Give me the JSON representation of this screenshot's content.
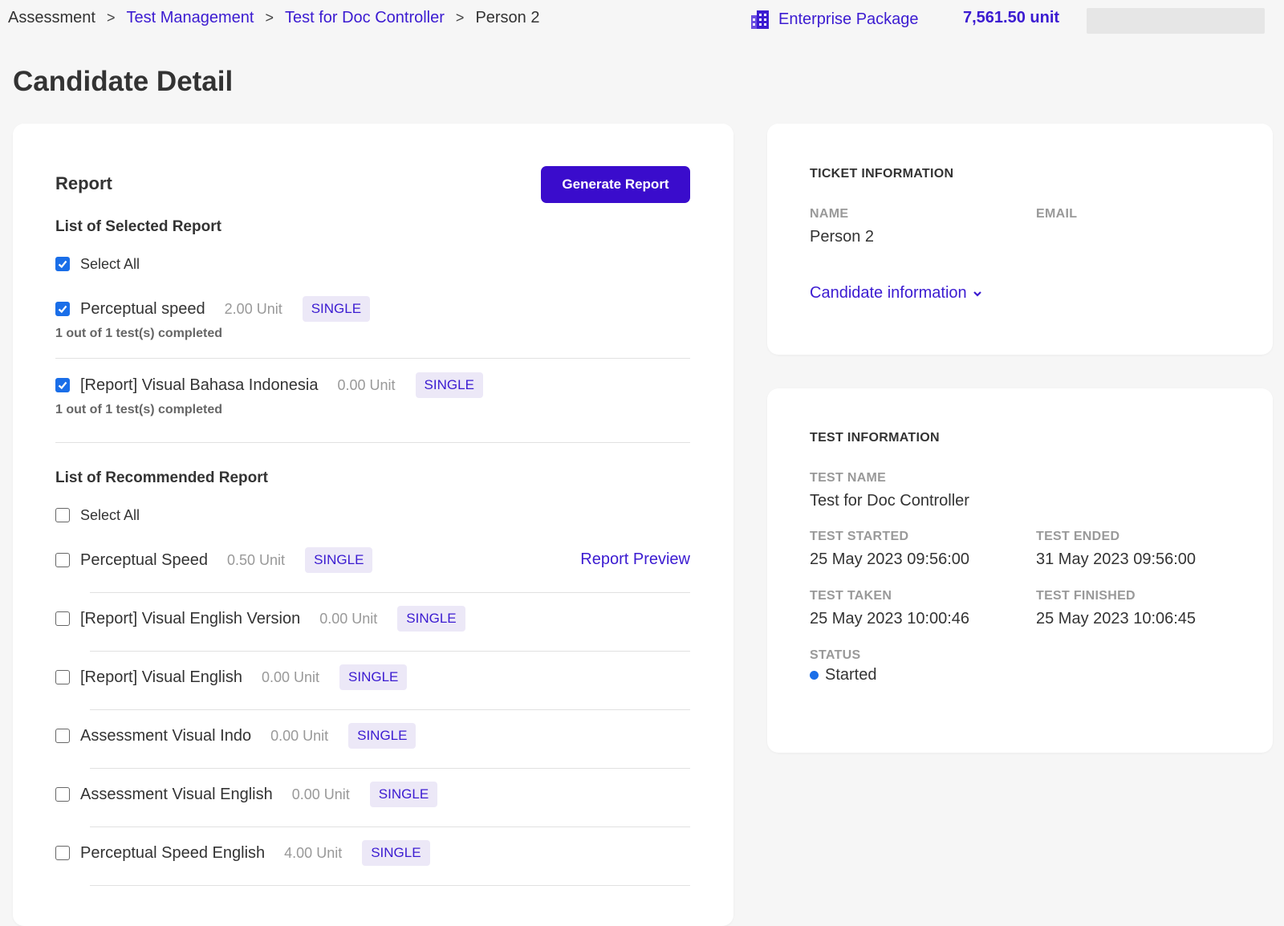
{
  "breadcrumb": {
    "items": [
      "Assessment",
      "Test Management",
      "Test for Doc Controller",
      "Person 2"
    ],
    "separator": ">"
  },
  "header": {
    "package_label": "Enterprise Package",
    "units": "7,561.50 unit",
    "package_icon": "building-icon"
  },
  "page_title": "Candidate Detail",
  "report": {
    "title": "Report",
    "generate_button": "Generate Report",
    "selected": {
      "title": "List of Selected Report",
      "select_all": "Select All",
      "select_all_checked": true,
      "items": [
        {
          "name": "Perceptual speed",
          "unit": "2.00 Unit",
          "badge": "SINGLE",
          "progress": "1 out of 1 test(s) completed",
          "checked": true
        },
        {
          "name": "[Report] Visual Bahasa Indonesia",
          "unit": "0.00 Unit",
          "badge": "SINGLE",
          "progress": "1 out of 1 test(s) completed",
          "checked": true
        }
      ]
    },
    "recommended": {
      "title": "List of Recommended Report",
      "select_all": "Select All",
      "select_all_checked": false,
      "preview_link": "Report Preview",
      "items": [
        {
          "name": "Perceptual Speed",
          "unit": "0.50 Unit",
          "badge": "SINGLE",
          "checked": false
        },
        {
          "name": "[Report] Visual English Version",
          "unit": "0.00 Unit",
          "badge": "SINGLE",
          "checked": false
        },
        {
          "name": "[Report] Visual English",
          "unit": "0.00 Unit",
          "badge": "SINGLE",
          "checked": false
        },
        {
          "name": "Assessment Visual Indo",
          "unit": "0.00 Unit",
          "badge": "SINGLE",
          "checked": false
        },
        {
          "name": "Assessment Visual English",
          "unit": "0.00 Unit",
          "badge": "SINGLE",
          "checked": false
        },
        {
          "name": "Perceptual Speed English",
          "unit": "4.00 Unit",
          "badge": "SINGLE",
          "checked": false
        }
      ]
    }
  },
  "ticket": {
    "title": "TICKET INFORMATION",
    "name_label": "NAME",
    "name_value": "Person 2",
    "email_label": "EMAIL",
    "email_value": "",
    "candidate_link": "Candidate information"
  },
  "test": {
    "title": "TEST INFORMATION",
    "name_label": "TEST NAME",
    "name_value": "Test for Doc Controller",
    "started_label": "TEST STARTED",
    "started_value": "25 May 2023 09:56:00",
    "ended_label": "TEST ENDED",
    "ended_value": "31 May 2023 09:56:00",
    "taken_label": "TEST TAKEN",
    "taken_value": "25 May 2023 10:00:46",
    "finished_label": "TEST FINISHED",
    "finished_value": "25 May 2023 10:06:45",
    "status_label": "STATUS",
    "status_value": "Started",
    "status_color": "#1a6ee8"
  },
  "colors": {
    "accent": "#3b1bd1",
    "button": "#3a0ccc",
    "checkbox": "#1a6ee8",
    "badge_bg": "#ece8f7"
  }
}
